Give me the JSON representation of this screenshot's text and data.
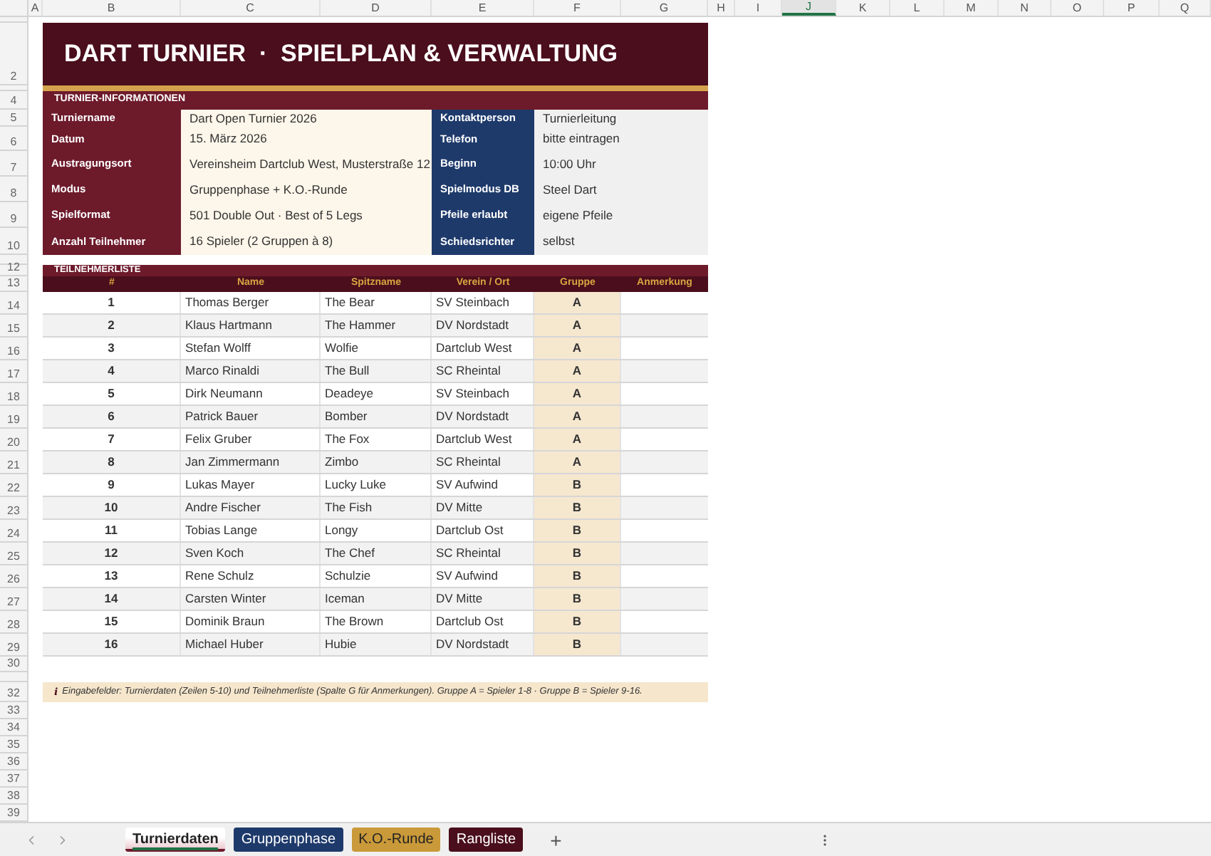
{
  "column_headers": [
    {
      "label": "A",
      "selected": false
    },
    {
      "label": "B",
      "selected": false
    },
    {
      "label": "C",
      "selected": false
    },
    {
      "label": "D",
      "selected": false
    },
    {
      "label": "E",
      "selected": false
    },
    {
      "label": "F",
      "selected": false
    },
    {
      "label": "G",
      "selected": false
    },
    {
      "label": "H",
      "selected": false
    },
    {
      "label": "I",
      "selected": false
    },
    {
      "label": "J",
      "selected": true
    },
    {
      "label": "K",
      "selected": false
    },
    {
      "label": "L",
      "selected": false
    },
    {
      "label": "M",
      "selected": false
    },
    {
      "label": "N",
      "selected": false
    },
    {
      "label": "O",
      "selected": false
    },
    {
      "label": "P",
      "selected": false
    },
    {
      "label": "Q",
      "selected": false
    }
  ],
  "row_numbers": [
    "2",
    "4",
    "5",
    "6",
    "7",
    "8",
    "9",
    "10",
    "12",
    "13",
    "14",
    "15",
    "16",
    "17",
    "18",
    "19",
    "20",
    "21",
    "22",
    "23",
    "24",
    "25",
    "26",
    "27",
    "28",
    "29",
    "30",
    "32",
    "33",
    "34",
    "35",
    "36",
    "37",
    "38",
    "39"
  ],
  "title": "DART TURNIER  ·  SPIELPLAN & VERWALTUNG",
  "info_section": {
    "title": "TURNIER-INFORMATIONEN",
    "rows": [
      {
        "label": "Turniername",
        "value": "Dart Open Turnier 2026",
        "label_2": "Kontaktperson",
        "value_2": "Turnierleitung"
      },
      {
        "label": "Datum",
        "value": "15. März 2026",
        "label_2": "Telefon",
        "value_2": "bitte eintragen"
      },
      {
        "label": "Austragungsort",
        "value": "Vereinsheim Dartclub West, Musterstraße 12",
        "label_2": "Beginn",
        "value_2": "10:00 Uhr"
      },
      {
        "label": "Modus",
        "value": "Gruppenphase + K.O.-Runde",
        "label_2": "Spielmodus DB",
        "value_2": "Steel Dart"
      },
      {
        "label": "Spielformat",
        "value": "501 Double Out · Best of 5 Legs",
        "label_2": "Pfeile erlaubt",
        "value_2": "eigene Pfeile"
      },
      {
        "label": "Anzahl Teilnehmer",
        "value": "16 Spieler (2 Gruppen à 8)",
        "label_2": "Schiedsrichter",
        "value_2": "selbst"
      }
    ]
  },
  "participants": {
    "title": "TEILNEHMERLISTE",
    "columns": [
      "#",
      "Name",
      "Spitzname",
      "Verein / Ort",
      "Gruppe",
      "Anmerkung"
    ],
    "rows": [
      {
        "number": "1",
        "name": "Thomas Berger",
        "nickname": "The Bear",
        "club": "SV Steinbach",
        "group": "A"
      },
      {
        "number": "2",
        "name": "Klaus Hartmann",
        "nickname": "The Hammer",
        "club": "DV Nordstadt",
        "group": "A"
      },
      {
        "number": "3",
        "name": "Stefan Wolff",
        "nickname": "Wolfie",
        "club": "Dartclub West",
        "group": "A"
      },
      {
        "number": "4",
        "name": "Marco Rinaldi",
        "nickname": "The Bull",
        "club": "SC Rheintal",
        "group": "A"
      },
      {
        "number": "5",
        "name": "Dirk Neumann",
        "nickname": "Deadeye",
        "club": "SV Steinbach",
        "group": "A"
      },
      {
        "number": "6",
        "name": "Patrick Bauer",
        "nickname": "Bomber",
        "club": "DV Nordstadt",
        "group": "A"
      },
      {
        "number": "7",
        "name": "Felix Gruber",
        "nickname": "The Fox",
        "club": "Dartclub West",
        "group": "A"
      },
      {
        "number": "8",
        "name": "Jan Zimmermann",
        "nickname": "Zimbo",
        "club": "SC Rheintal",
        "group": "A"
      },
      {
        "number": "9",
        "name": "Lukas Mayer",
        "nickname": "Lucky Luke",
        "club": "SV Aufwind",
        "group": "B"
      },
      {
        "number": "10",
        "name": "Andre Fischer",
        "nickname": "The Fish",
        "club": "DV Mitte",
        "group": "B"
      },
      {
        "number": "11",
        "name": "Tobias Lange",
        "nickname": "Longy",
        "club": "Dartclub Ost",
        "group": "B"
      },
      {
        "number": "12",
        "name": "Sven Koch",
        "nickname": "The Chef",
        "club": "SC Rheintal",
        "group": "B"
      },
      {
        "number": "13",
        "name": "Rene Schulz",
        "nickname": "Schulzie",
        "club": "SV Aufwind",
        "group": "B"
      },
      {
        "number": "14",
        "name": "Carsten Winter",
        "nickname": "Iceman",
        "club": "DV Mitte",
        "group": "B"
      },
      {
        "number": "15",
        "name": "Dominik Braun",
        "nickname": "The Brown",
        "club": "Dartclub Ost",
        "group": "B"
      },
      {
        "number": "16",
        "name": "Michael Huber",
        "nickname": "Hubie",
        "club": "DV Nordstadt",
        "group": "B"
      }
    ]
  },
  "note": {
    "mark": "i",
    "text": "Eingabefelder: Turnierdaten (Zeilen 5-10) und Teilnehmerliste (Spalte G für Anmerkungen). Gruppe A = Spieler 1-8 · Gruppe B = Spieler 9-16."
  },
  "sheet_tabs": [
    {
      "label": "Turnierdaten",
      "selected": true,
      "color": "#6d1a2b"
    },
    {
      "label": "Gruppenphase",
      "selected": false,
      "color": "#1e3a6b"
    },
    {
      "label": "K.O.-Runde",
      "selected": false,
      "color": "#c9993a"
    },
    {
      "label": "Rangliste",
      "selected": false,
      "color": "#4a0e1c"
    }
  ],
  "add_sheet": "+"
}
